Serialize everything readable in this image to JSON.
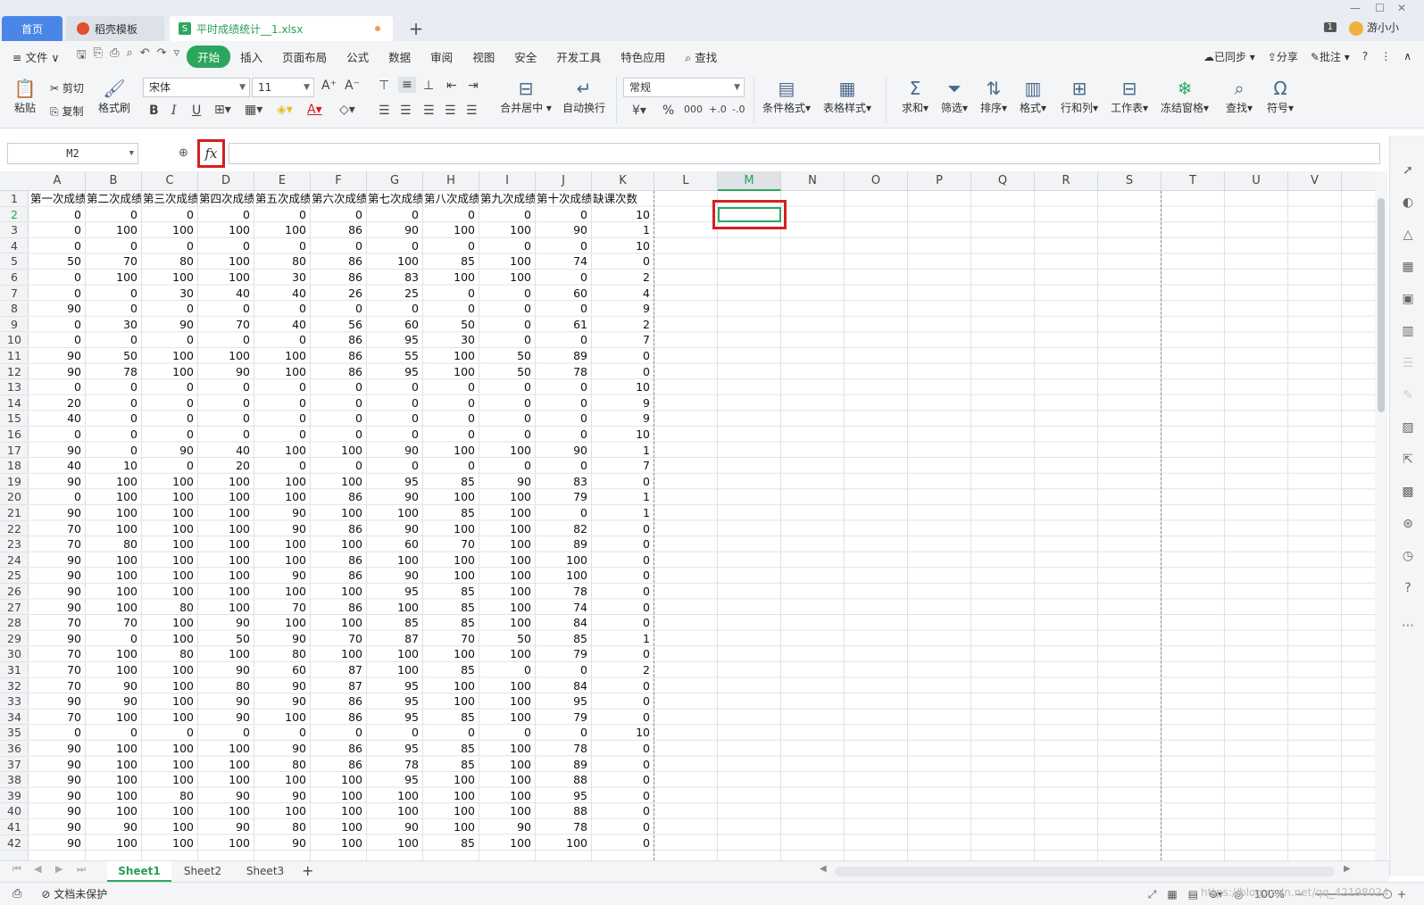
{
  "titlebar": {
    "tabs": [
      {
        "label": "首页"
      },
      {
        "label": "稻壳模板"
      },
      {
        "label": "平时成绩统计__1.xlsx"
      }
    ],
    "page_count": "1",
    "user": "游小小"
  },
  "menubar": {
    "file": "≡ 文件 ∨",
    "items": [
      "开始",
      "插入",
      "页面布局",
      "公式",
      "数据",
      "审阅",
      "视图",
      "安全",
      "开发工具",
      "特色应用"
    ],
    "search": "查找",
    "right": [
      "已同步",
      "分享",
      "批注"
    ],
    "help": "?"
  },
  "ribbon": {
    "paste": "粘贴",
    "cut": "剪切",
    "copy": "复制",
    "format_painter": "格式刷",
    "font": "宋体",
    "font_size": "11",
    "merge": "合并居中",
    "wrap": "自动换行",
    "number_format": "常规",
    "cond_format": "条件格式",
    "table_style": "表格样式",
    "sum": "求和",
    "filter": "筛选",
    "sort": "排序",
    "format": "格式",
    "row_col": "行和列",
    "worksheet": "工作表",
    "freeze": "冻结窗格",
    "find": "查找",
    "symbol": "符号"
  },
  "formula_bar": {
    "name_box": "M2",
    "fx": "fx",
    "value": ""
  },
  "grid": {
    "columns": [
      "A",
      "B",
      "C",
      "D",
      "E",
      "F",
      "G",
      "H",
      "I",
      "J",
      "K",
      "L",
      "M",
      "N",
      "O",
      "P",
      "Q",
      "R",
      "S",
      "T",
      "U",
      "V"
    ],
    "selected_column": "M",
    "selected_row": "2",
    "header_row": [
      "第一次成绩",
      "第二次成绩",
      "第三次成绩",
      "第四次成绩",
      "第五次成绩",
      "第六次成绩",
      "第七次成绩",
      "第八次成绩",
      "第九次成绩",
      "第十次成绩",
      "缺课次数"
    ],
    "row_numbers": [
      "1",
      "2",
      "3",
      "4",
      "5",
      "6",
      "7",
      "8",
      "9",
      "10",
      "11",
      "12",
      "13",
      "14",
      "15",
      "16",
      "17",
      "18",
      "19",
      "20",
      "21",
      "22",
      "23",
      "24",
      "25",
      "26",
      "27",
      "28",
      "29",
      "30",
      "31",
      "32",
      "33",
      "34",
      "35",
      "36",
      "37",
      "38",
      "39",
      "40",
      "41",
      "42"
    ],
    "rows": [
      [
        "0",
        "0",
        "0",
        "0",
        "0",
        "0",
        "0",
        "0",
        "0",
        "0",
        "10"
      ],
      [
        "0",
        "100",
        "100",
        "100",
        "100",
        "86",
        "90",
        "100",
        "100",
        "90",
        "1"
      ],
      [
        "0",
        "0",
        "0",
        "0",
        "0",
        "0",
        "0",
        "0",
        "0",
        "0",
        "10"
      ],
      [
        "50",
        "70",
        "80",
        "100",
        "80",
        "86",
        "100",
        "85",
        "100",
        "74",
        "0"
      ],
      [
        "0",
        "100",
        "100",
        "100",
        "30",
        "86",
        "83",
        "100",
        "100",
        "0",
        "2"
      ],
      [
        "0",
        "0",
        "30",
        "40",
        "40",
        "26",
        "25",
        "0",
        "0",
        "60",
        "4"
      ],
      [
        "90",
        "0",
        "0",
        "0",
        "0",
        "0",
        "0",
        "0",
        "0",
        "0",
        "9"
      ],
      [
        "0",
        "30",
        "90",
        "70",
        "40",
        "56",
        "60",
        "50",
        "0",
        "61",
        "2"
      ],
      [
        "0",
        "0",
        "0",
        "0",
        "0",
        "86",
        "95",
        "30",
        "0",
        "0",
        "7"
      ],
      [
        "90",
        "50",
        "100",
        "100",
        "100",
        "86",
        "55",
        "100",
        "50",
        "89",
        "0"
      ],
      [
        "90",
        "78",
        "100",
        "90",
        "100",
        "86",
        "95",
        "100",
        "50",
        "78",
        "0"
      ],
      [
        "0",
        "0",
        "0",
        "0",
        "0",
        "0",
        "0",
        "0",
        "0",
        "0",
        "10"
      ],
      [
        "20",
        "0",
        "0",
        "0",
        "0",
        "0",
        "0",
        "0",
        "0",
        "0",
        "9"
      ],
      [
        "40",
        "0",
        "0",
        "0",
        "0",
        "0",
        "0",
        "0",
        "0",
        "0",
        "9"
      ],
      [
        "0",
        "0",
        "0",
        "0",
        "0",
        "0",
        "0",
        "0",
        "0",
        "0",
        "10"
      ],
      [
        "90",
        "0",
        "90",
        "40",
        "100",
        "100",
        "90",
        "100",
        "100",
        "90",
        "1"
      ],
      [
        "40",
        "10",
        "0",
        "20",
        "0",
        "0",
        "0",
        "0",
        "0",
        "0",
        "7"
      ],
      [
        "90",
        "100",
        "100",
        "100",
        "100",
        "100",
        "95",
        "85",
        "90",
        "83",
        "0"
      ],
      [
        "0",
        "100",
        "100",
        "100",
        "100",
        "86",
        "90",
        "100",
        "100",
        "79",
        "1"
      ],
      [
        "90",
        "100",
        "100",
        "100",
        "90",
        "100",
        "100",
        "85",
        "100",
        "0",
        "1"
      ],
      [
        "70",
        "100",
        "100",
        "100",
        "90",
        "86",
        "90",
        "100",
        "100",
        "82",
        "0"
      ],
      [
        "70",
        "80",
        "100",
        "100",
        "100",
        "100",
        "60",
        "70",
        "100",
        "89",
        "0"
      ],
      [
        "90",
        "100",
        "100",
        "100",
        "100",
        "86",
        "100",
        "100",
        "100",
        "100",
        "0"
      ],
      [
        "90",
        "100",
        "100",
        "100",
        "90",
        "86",
        "90",
        "100",
        "100",
        "100",
        "0"
      ],
      [
        "90",
        "100",
        "100",
        "100",
        "100",
        "100",
        "95",
        "85",
        "100",
        "78",
        "0"
      ],
      [
        "90",
        "100",
        "80",
        "100",
        "70",
        "86",
        "100",
        "85",
        "100",
        "74",
        "0"
      ],
      [
        "70",
        "70",
        "100",
        "90",
        "100",
        "100",
        "85",
        "85",
        "100",
        "84",
        "0"
      ],
      [
        "90",
        "0",
        "100",
        "50",
        "90",
        "70",
        "87",
        "70",
        "50",
        "85",
        "1"
      ],
      [
        "70",
        "100",
        "80",
        "100",
        "80",
        "100",
        "100",
        "100",
        "100",
        "79",
        "0"
      ],
      [
        "70",
        "100",
        "100",
        "90",
        "60",
        "87",
        "100",
        "85",
        "0",
        "0",
        "2"
      ],
      [
        "70",
        "90",
        "100",
        "80",
        "90",
        "87",
        "95",
        "100",
        "100",
        "84",
        "0"
      ],
      [
        "90",
        "90",
        "100",
        "90",
        "90",
        "86",
        "95",
        "100",
        "100",
        "95",
        "0"
      ],
      [
        "70",
        "100",
        "100",
        "90",
        "100",
        "86",
        "95",
        "85",
        "100",
        "79",
        "0"
      ],
      [
        "0",
        "0",
        "0",
        "0",
        "0",
        "0",
        "0",
        "0",
        "0",
        "0",
        "10"
      ],
      [
        "90",
        "100",
        "100",
        "100",
        "90",
        "86",
        "95",
        "85",
        "100",
        "78",
        "0"
      ],
      [
        "90",
        "100",
        "100",
        "100",
        "80",
        "86",
        "78",
        "85",
        "100",
        "89",
        "0"
      ],
      [
        "90",
        "100",
        "100",
        "100",
        "100",
        "100",
        "95",
        "100",
        "100",
        "88",
        "0"
      ],
      [
        "90",
        "100",
        "80",
        "90",
        "90",
        "100",
        "100",
        "100",
        "100",
        "95",
        "0"
      ],
      [
        "90",
        "100",
        "100",
        "100",
        "100",
        "100",
        "100",
        "100",
        "100",
        "88",
        "0"
      ],
      [
        "90",
        "90",
        "100",
        "90",
        "80",
        "100",
        "90",
        "100",
        "90",
        "78",
        "0"
      ],
      [
        "90",
        "100",
        "100",
        "100",
        "90",
        "100",
        "100",
        "85",
        "100",
        "100",
        "0"
      ]
    ]
  },
  "sheets": [
    "Sheet1",
    "Sheet2",
    "Sheet3"
  ],
  "status": {
    "protect": "文档未保护",
    "zoom": "100%",
    "watermark": "https://blog.csdn.net/qq_42198024"
  }
}
